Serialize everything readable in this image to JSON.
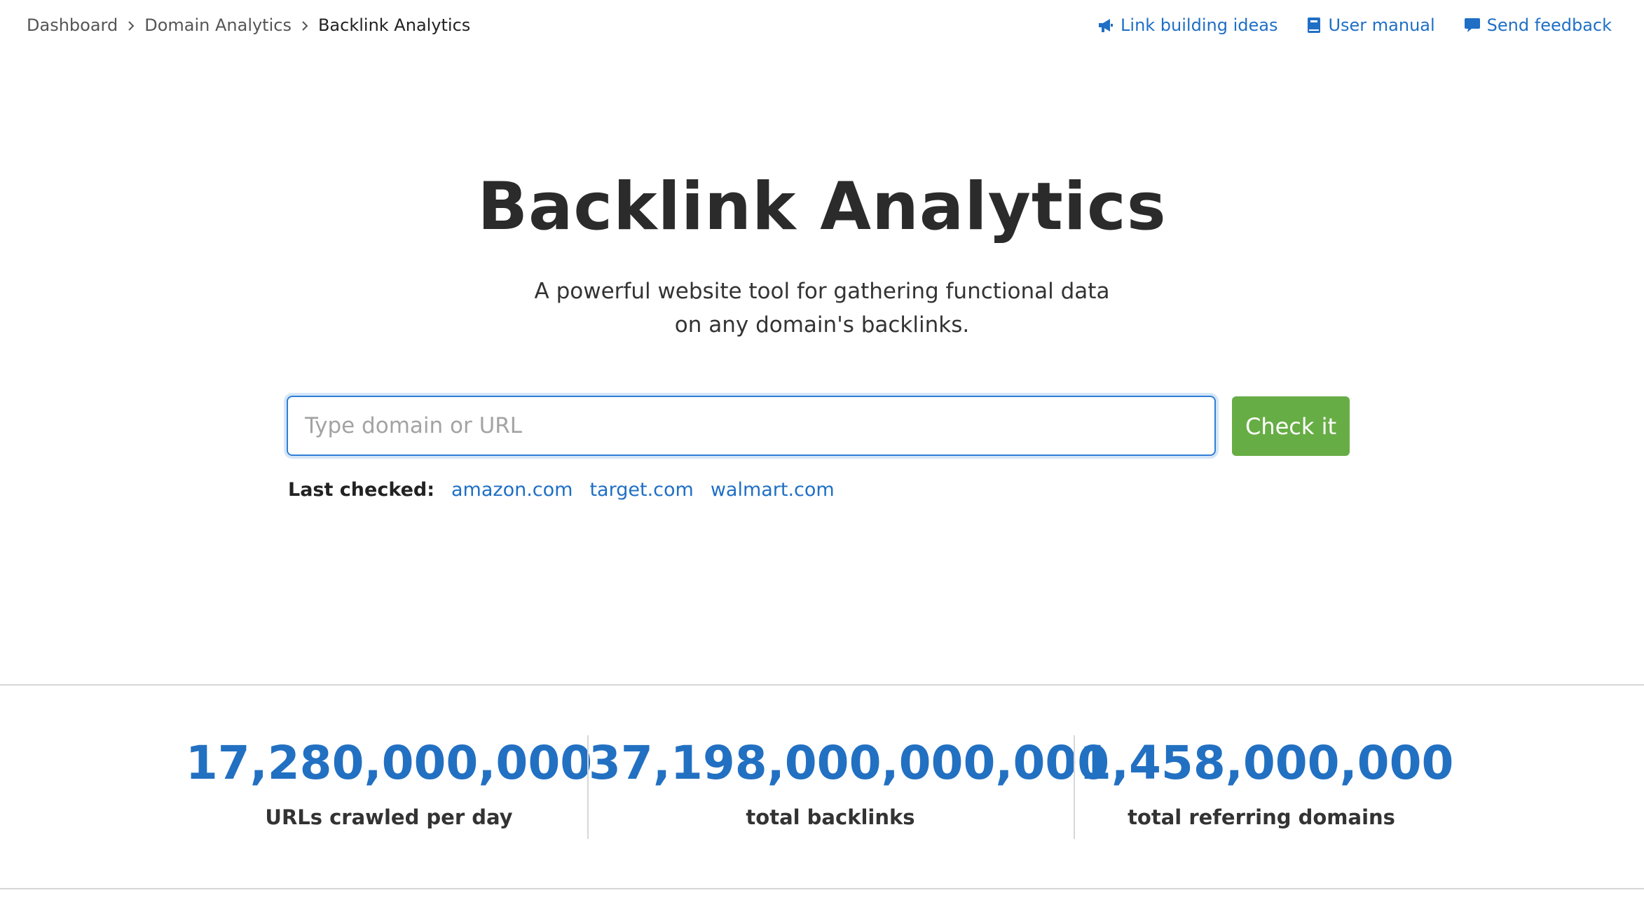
{
  "breadcrumb": {
    "items": [
      "Dashboard",
      "Domain Analytics",
      "Backlink Analytics"
    ]
  },
  "top_links": {
    "link_building": {
      "label": "Link building ideas",
      "icon": "megaphone-icon"
    },
    "user_manual": {
      "label": "User manual",
      "icon": "book-icon"
    },
    "send_feedback": {
      "label": "Send feedback",
      "icon": "chat-bubble-icon"
    }
  },
  "hero": {
    "title": "Backlink Analytics",
    "subtitle_line1": "A powerful website tool for gathering functional data",
    "subtitle_line2": "on any domain's backlinks."
  },
  "search": {
    "placeholder": "Type domain or URL",
    "value": "",
    "button_label": "Check it"
  },
  "last_checked": {
    "label": "Last checked:",
    "domains": [
      "amazon.com",
      "target.com",
      "walmart.com"
    ]
  },
  "stats": [
    {
      "value": "17,280,000,000",
      "label": "URLs crawled per day"
    },
    {
      "value": "37,198,000,000,000",
      "label": "total backlinks"
    },
    {
      "value": "1,458,000,000",
      "label": "total referring domains"
    }
  ],
  "colors": {
    "link": "#1f6fc5",
    "stat_value": "#2270c2",
    "button": "#67ad45",
    "input_border": "#2e7fd6",
    "text": "#333333"
  }
}
